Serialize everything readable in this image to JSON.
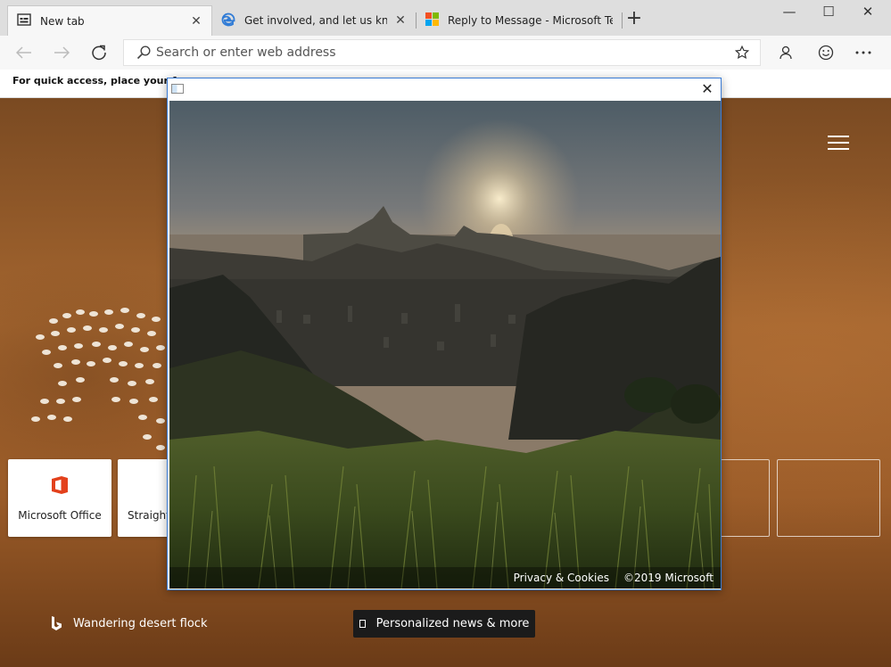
{
  "browser": {
    "tabs": [
      {
        "title": "New tab",
        "icon": "newtab-page-icon",
        "active": true
      },
      {
        "title": "Get involved, and let us know wh",
        "icon": "edge-logo-icon",
        "active": false
      },
      {
        "title": "Reply to Message - Microsoft Te",
        "icon": "microsoft-logo-icon",
        "active": false
      }
    ],
    "address_placeholder": "Search or enter web address",
    "favorites_hint": "For quick access, place your favor",
    "window_controls": {
      "minimize": "—",
      "maximize": "☐",
      "close": "✕"
    }
  },
  "newtab": {
    "top_sites": [
      {
        "label": "Microsoft Office",
        "icon": "office-logo-icon"
      },
      {
        "label": "Straight",
        "icon": "edge-logo-icon"
      }
    ],
    "image_credit": "Wandering desert flock",
    "news_button": "Personalized news & more"
  },
  "popup": {
    "close_glyph": "✕",
    "footer": {
      "privacy": "Privacy & Cookies",
      "copyright": "©2019 Microsoft"
    }
  },
  "colors": {
    "popup_border": "#3a7bd5",
    "office_red": "#e3411c",
    "edge_blue": "#2f7bd6"
  }
}
